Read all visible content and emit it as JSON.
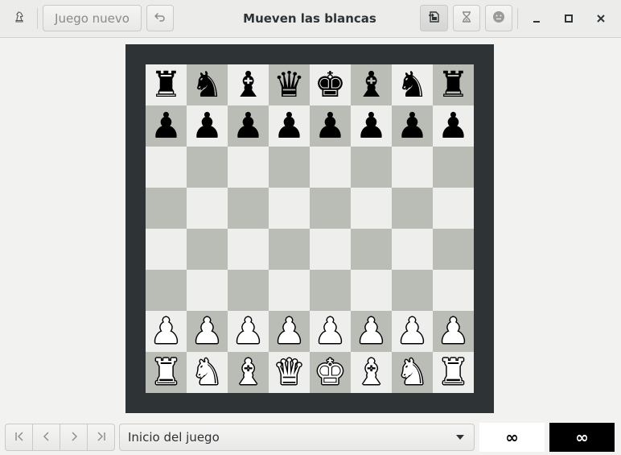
{
  "window": {
    "title": "Mueven las blancas"
  },
  "header": {
    "app_icon": "chess-knight-icon",
    "new_game_label": "Juego nuevo",
    "undo_icon": "undo-arrow-icon",
    "save_icon": "save-document-icon",
    "claim_draw_icon": "hourglass-icon",
    "resign_icon": "face-neutral-icon",
    "minimize_icon": "minimize-icon",
    "maximize_icon": "maximize-icon",
    "close_icon": "close-icon"
  },
  "board": {
    "ranks": [
      [
        "♜",
        "♞",
        "♝",
        "♛",
        "♚",
        "♝",
        "♞",
        "♜"
      ],
      [
        "♟",
        "♟",
        "♟",
        "♟",
        "♟",
        "♟",
        "♟",
        "♟"
      ],
      [
        "",
        "",
        "",
        "",
        "",
        "",
        "",
        ""
      ],
      [
        "",
        "",
        "",
        "",
        "",
        "",
        "",
        ""
      ],
      [
        "",
        "",
        "",
        "",
        "",
        "",
        "",
        ""
      ],
      [
        "",
        "",
        "",
        "",
        "",
        "",
        "",
        ""
      ],
      [
        "♟",
        "♟",
        "♟",
        "♟",
        "♟",
        "♟",
        "♟",
        "♟"
      ],
      [
        "♜",
        "♞",
        "♝",
        "♛",
        "♚",
        "♝",
        "♞",
        "♜"
      ]
    ],
    "colors": {
      "light_square": "#eeeeec",
      "dark_square": "#babdb6",
      "frame": "#2e3436"
    }
  },
  "bottom": {
    "nav": [
      {
        "name": "first-move-icon",
        "glyph": "first"
      },
      {
        "name": "previous-move-icon",
        "glyph": "prev"
      },
      {
        "name": "next-move-icon",
        "glyph": "next"
      },
      {
        "name": "last-move-icon",
        "glyph": "last"
      }
    ],
    "move_select_value": "Inicio del juego",
    "white_clock": "∞",
    "black_clock": "∞"
  }
}
